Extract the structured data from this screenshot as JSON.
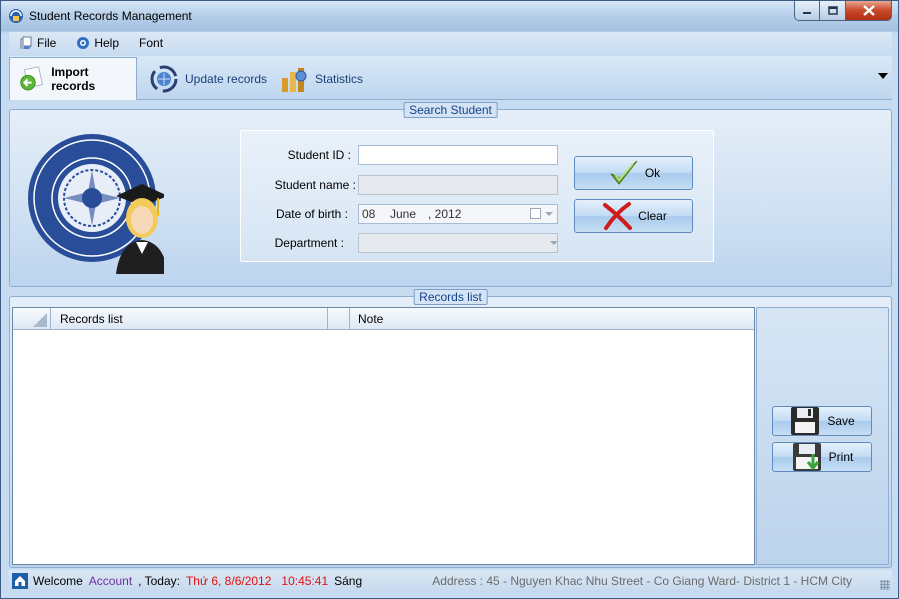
{
  "window": {
    "title": "Student Records Management"
  },
  "menu": {
    "items": [
      {
        "label": "File",
        "icon": "file-icon"
      },
      {
        "label": "Help",
        "icon": "help-icon"
      },
      {
        "label": "Font",
        "icon": ""
      }
    ]
  },
  "tabs": [
    {
      "label": "Import records",
      "icon": "import-arrow-icon",
      "active": true
    },
    {
      "label": "Update records",
      "icon": "update-globe-icon",
      "active": false
    },
    {
      "label": "Statistics",
      "icon": "statistics-icon",
      "active": false
    }
  ],
  "search": {
    "title": "Search Student",
    "student_id_label": "Student ID :",
    "student_id_value": "",
    "student_name_label": "Student name :",
    "student_name_value": "",
    "dob_label": "Date of birth :",
    "dob_day": "08",
    "dob_month": "June",
    "dob_year": ", 2012",
    "department_label": "Department :",
    "department_value": "",
    "ok_label": "Ok",
    "clear_label": "Clear"
  },
  "records": {
    "title": "Records list",
    "columns": [
      "Records list",
      "",
      "Note"
    ],
    "rows": [],
    "save_label": "Save",
    "print_label": "Print"
  },
  "status": {
    "welcome": "Welcome",
    "account": "Account",
    "today_label": ", Today:",
    "date": "Thứ 6, 8/6/2012",
    "time": "10:45:41",
    "period": "Sáng",
    "address": "Address : 45 - Nguyen Khac Nhu Street - Co Giang Ward- District 1 - HCM City"
  },
  "colors": {
    "accent": "#15428b",
    "account": "#7030a0",
    "date_time": "#e01010",
    "close_button": "#c8482a"
  }
}
